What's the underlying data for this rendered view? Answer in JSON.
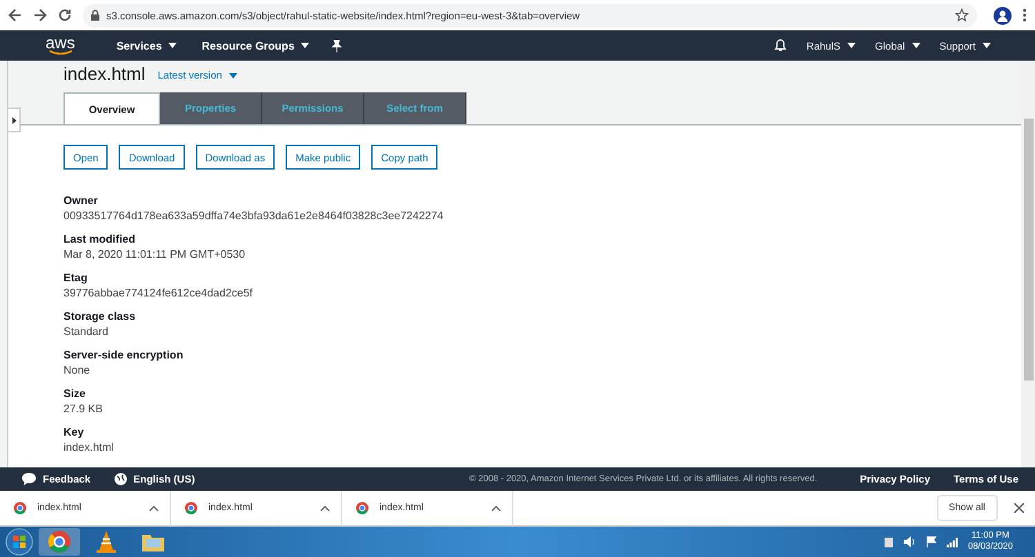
{
  "browser": {
    "url": "s3.console.aws.amazon.com/s3/object/rahul-static-website/index.html?region=eu-west-3&tab=overview"
  },
  "nav": {
    "logo": "aws",
    "menus": [
      "Services",
      "Resource Groups"
    ],
    "right_menus": [
      "RahulS",
      "Global",
      "Support"
    ]
  },
  "object": {
    "title": "index.html",
    "version": "Latest version"
  },
  "tabs": [
    {
      "label": "Overview",
      "selected": true
    },
    {
      "label": "Properties",
      "selected": false
    },
    {
      "label": "Permissions",
      "selected": false
    },
    {
      "label": "Select from",
      "selected": false
    }
  ],
  "actions": [
    "Open",
    "Download",
    "Download as",
    "Make public",
    "Copy path"
  ],
  "properties": [
    {
      "label": "Owner",
      "value": "00933517764d178ea633a59dffa74e3bfa93da61e2e8464f03828c3ee7242274"
    },
    {
      "label": "Last modified",
      "value": "Mar 8, 2020 11:01:11 PM GMT+0530"
    },
    {
      "label": "Etag",
      "value": "39776abbae774124fe612ce4dad2ce5f"
    },
    {
      "label": "Storage class",
      "value": "Standard"
    },
    {
      "label": "Server-side encryption",
      "value": "None"
    },
    {
      "label": "Size",
      "value": "27.9 KB"
    },
    {
      "label": "Key",
      "value": "index.html"
    }
  ],
  "footer": {
    "feedback": "Feedback",
    "language": "English (US)",
    "copyright": "© 2008 - 2020, Amazon Internet Services Private Ltd. or its affiliates. All rights reserved.",
    "links": [
      "Privacy Policy",
      "Terms of Use"
    ]
  },
  "downloads": {
    "items": [
      "index.html",
      "index.html",
      "index.html"
    ],
    "show_all": "Show all"
  },
  "taskbar": {
    "time": "11:00 PM",
    "date": "08/03/2020"
  }
}
